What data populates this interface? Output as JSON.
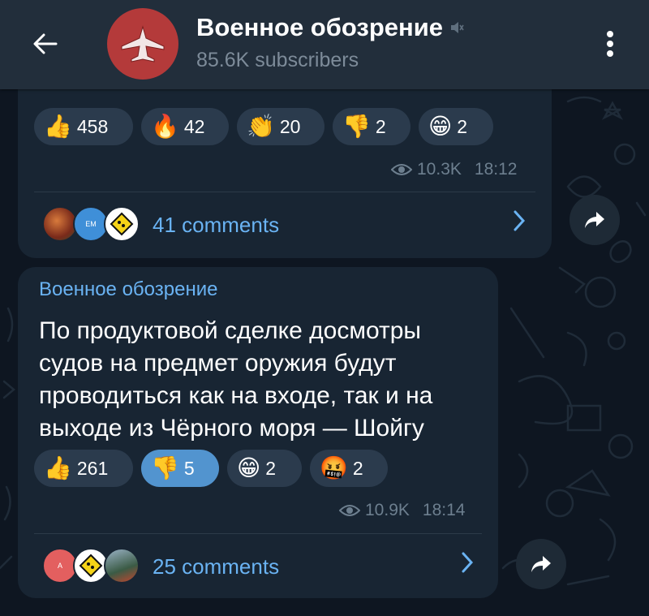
{
  "header": {
    "title": "Военное обозрение",
    "subtitle": "85.6K subscribers",
    "back_icon": "arrow-left-icon",
    "mute_icon": "muted-speaker-icon",
    "menu_icon": "more-vertical-icon"
  },
  "post1": {
    "reactions": [
      {
        "emoji": "👍",
        "count": "458"
      },
      {
        "emoji": "🔥",
        "count": "42"
      },
      {
        "emoji": "👏",
        "count": "20"
      },
      {
        "emoji": "👎",
        "count": "2"
      },
      {
        "emoji": "😁",
        "count": "2"
      }
    ],
    "views": "10.3K",
    "time": "18:12",
    "comments": "41 comments",
    "avatar_badge": "EM"
  },
  "post2": {
    "sender": "Военное обозрение",
    "text": "По продуктовой сделке досмотры судов на предмет оружия будут проводиться как на входе, так и на выходе из Чёрного моря — Шойгу",
    "reactions": [
      {
        "emoji": "👍",
        "count": "261",
        "active": false
      },
      {
        "emoji": "👎",
        "count": "5",
        "active": true
      },
      {
        "emoji": "😁",
        "count": "2",
        "active": false
      },
      {
        "emoji": "🤬",
        "count": "2",
        "active": false
      }
    ],
    "views": "10.9K",
    "time": "18:14",
    "comments": "25 comments",
    "avatar_letter": "A"
  },
  "colors": {
    "background": "#0e1621",
    "header": "#222e3b",
    "bubble": "#182533",
    "reaction": "#2b3b4d",
    "reaction_active": "#5294cf",
    "link": "#6ab3f3",
    "meta": "#6d7f8f",
    "avatar": "#b43a3a"
  }
}
